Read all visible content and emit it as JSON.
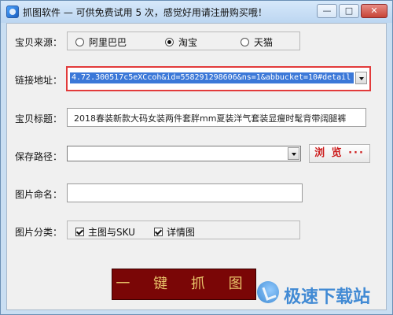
{
  "window": {
    "title": "抓图软件 — 可供免费试用 5 次，感觉好用请注册购买哦！",
    "buttons": {
      "minimize": "—",
      "maximize": "□",
      "close": "✕"
    }
  },
  "form": {
    "source": {
      "label": "宝贝来源：",
      "options": [
        "阿里巴巴",
        "淘宝",
        "天猫"
      ],
      "selected": "淘宝"
    },
    "url": {
      "label": "链接地址：",
      "value": "4.72.300517c5eXCcoh&id=558291298606&ns=1&abbucket=10#detail"
    },
    "item_title": {
      "label": "宝贝标题：",
      "value": "2018春装新款大码女装两件套胖mm夏装洋气套装显瘦时髦背带阔腿裤"
    },
    "save_path": {
      "label": "保存路径：",
      "value": "",
      "browse_label": "浏 览 ···"
    },
    "image_name": {
      "label": "图片命名：",
      "value": ""
    },
    "image_category": {
      "label": "图片分类：",
      "options": [
        {
          "label": "主图与SKU",
          "checked": true
        },
        {
          "label": "详情图",
          "checked": true
        }
      ]
    },
    "capture_button": "一 键 抓 图"
  },
  "watermark": {
    "icon": "jisuxiazai-logo-icon",
    "text": "极速下载站"
  }
}
